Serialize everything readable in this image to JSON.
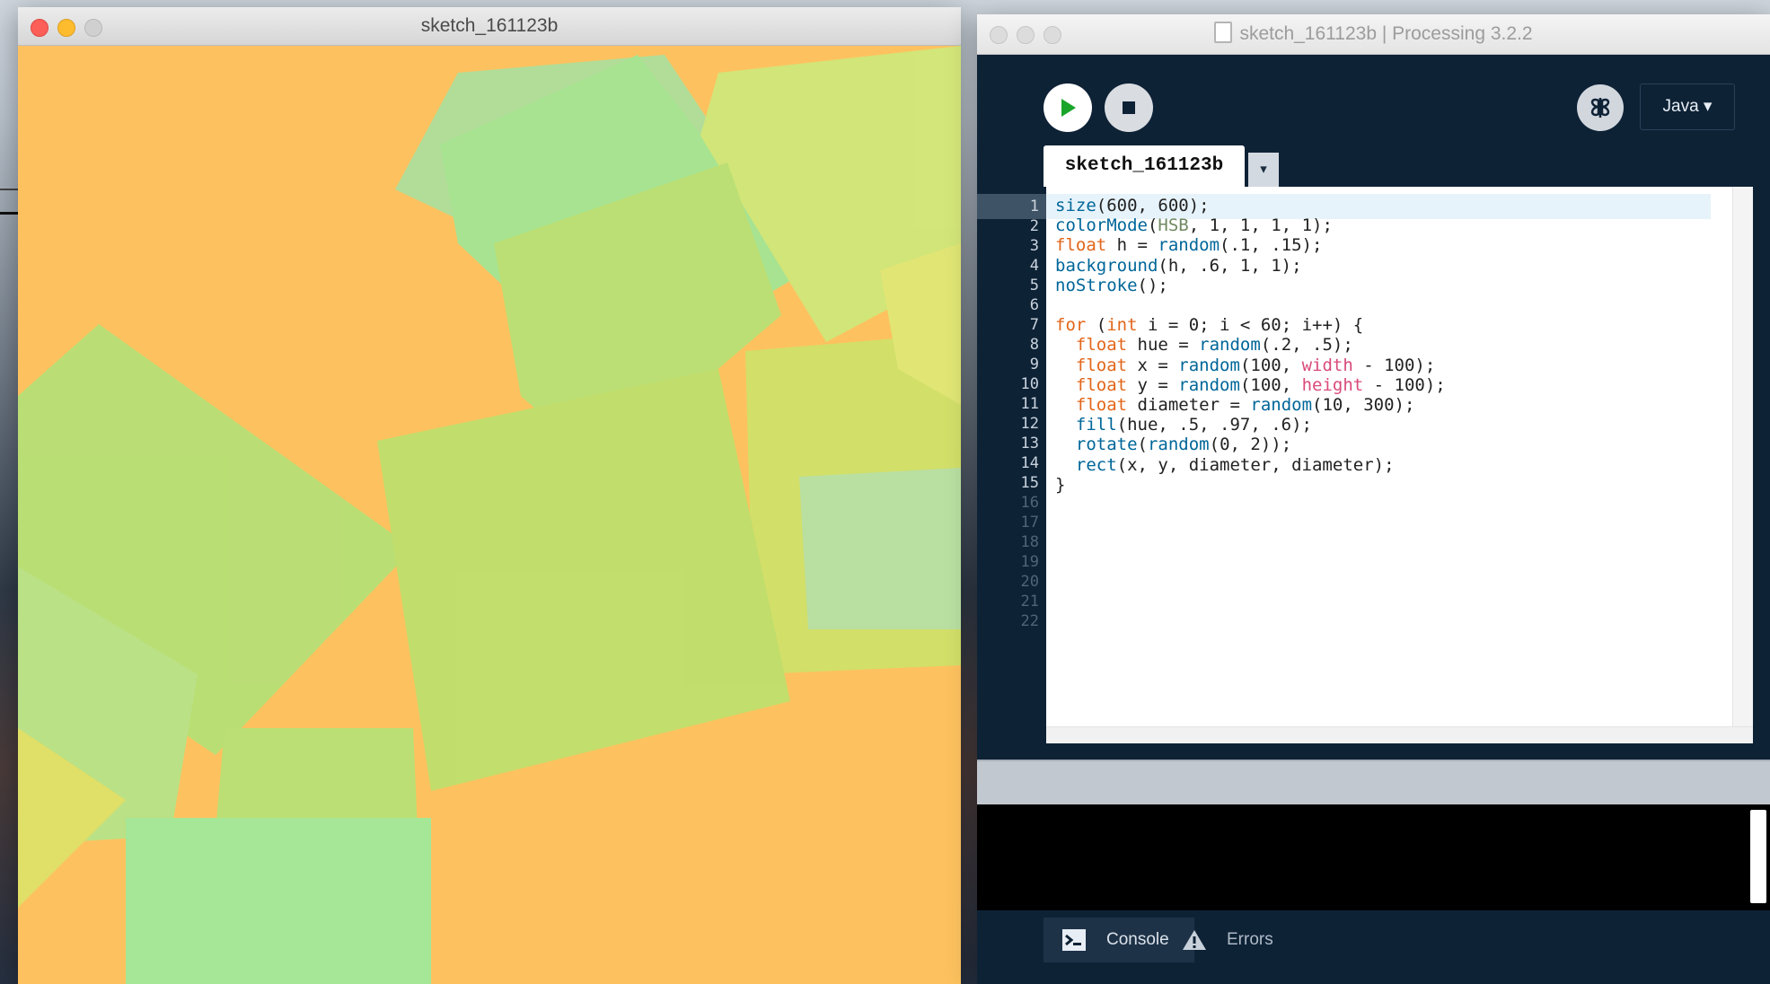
{
  "sketch_window": {
    "title": "sketch_161123b",
    "background_color": "#fdc25f"
  },
  "ide_window": {
    "title": "sketch_161123b | Processing 3.2.2",
    "toolbar": {
      "run_icon": "play-icon",
      "stop_icon": "stop-icon",
      "debug_icon": "debugger-butterfly-icon",
      "mode_label": "Java ▾"
    },
    "tab": {
      "label": "sketch_161123b",
      "menu_glyph": "▾"
    },
    "editor": {
      "line_numbers": [
        "1",
        "2",
        "3",
        "4",
        "5",
        "6",
        "7",
        "8",
        "9",
        "10",
        "11",
        "12",
        "13",
        "14",
        "15",
        "16",
        "17",
        "18",
        "19",
        "20",
        "21",
        "22"
      ],
      "current_line": 1,
      "code": [
        "size(600, 600);",
        "colorMode(HSB, 1, 1, 1, 1);",
        "float h = random(.1, .15);",
        "background(h, .6, 1, 1);",
        "noStroke();",
        "",
        "for (int i = 0; i < 60; i++) {",
        "  float hue = random(.2, .5);",
        "  float x = random(100, width - 100);",
        "  float y = random(100, height - 100);",
        "  float diameter = random(10, 300);",
        "  fill(hue, .5, .97, .6);",
        "  rotate(random(0, 2));",
        "  rect(x, y, diameter, diameter);",
        "}"
      ]
    },
    "bottom_tabs": {
      "console_label": "Console",
      "errors_label": "Errors"
    }
  },
  "colors": {
    "ide_dark": "#0e2236",
    "keyword": "#e2661a",
    "function": "#006699",
    "constant": "#718a62",
    "builtin_var": "#d94a7a"
  }
}
